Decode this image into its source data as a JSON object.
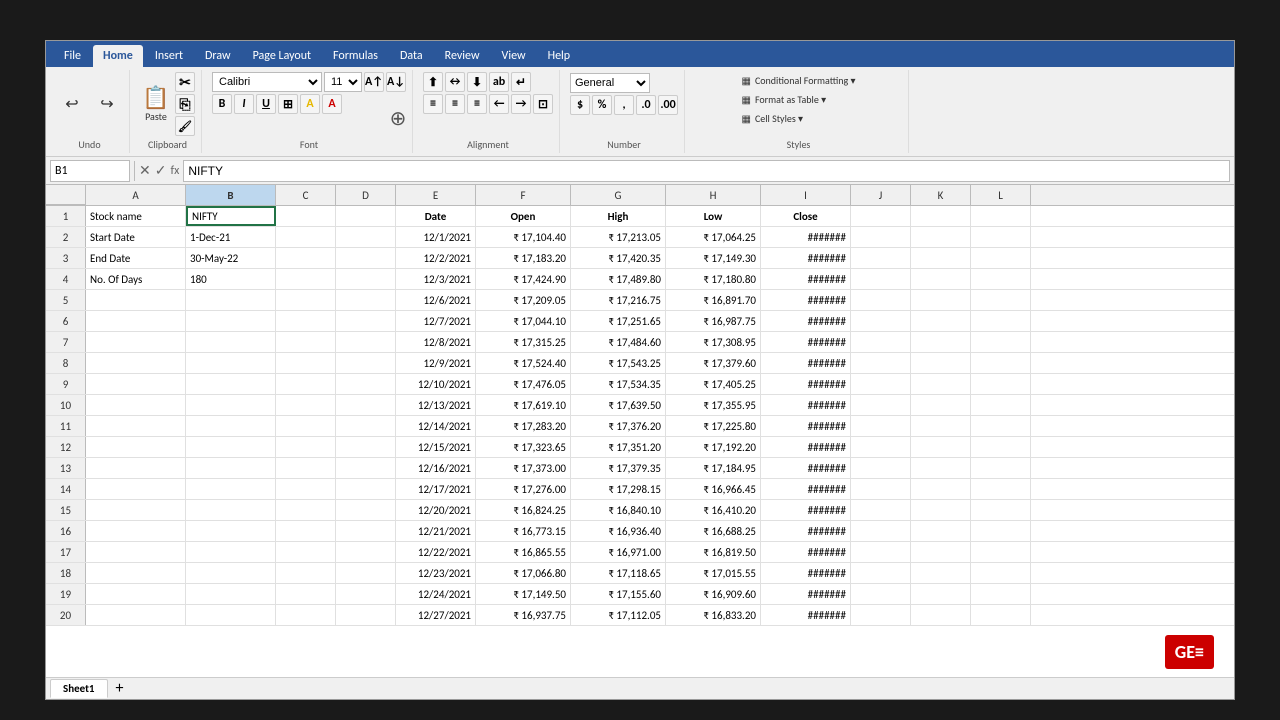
{
  "ribbon": {
    "tabs": [
      "File",
      "Home",
      "Insert",
      "Draw",
      "Page Layout",
      "Formulas",
      "Data",
      "Review",
      "View",
      "Help"
    ],
    "active_tab": "Home",
    "font_name": "Calibri",
    "font_size": "11",
    "cell_ref": "B1",
    "formula_value": "NIFTY"
  },
  "columns": {
    "headers": [
      "A",
      "B",
      "C",
      "D",
      "E",
      "F",
      "G",
      "H",
      "I",
      "J",
      "K",
      "L"
    ]
  },
  "rows": [
    {
      "num": 1,
      "cells": [
        "Stock name",
        "NIFTY",
        "",
        "",
        "Date",
        "Open",
        "High",
        "Low",
        "Close",
        "",
        "",
        ""
      ]
    },
    {
      "num": 2,
      "cells": [
        "Start Date",
        "1-Dec-21",
        "",
        "",
        "12/1/2021",
        "₹ 17,104.40",
        "₹ 17,213.05",
        "₹ 17,064.25",
        "#######",
        "",
        "",
        ""
      ]
    },
    {
      "num": 3,
      "cells": [
        "End Date",
        "30-May-22",
        "",
        "",
        "12/2/2021",
        "₹ 17,183.20",
        "₹ 17,420.35",
        "₹ 17,149.30",
        "#######",
        "",
        "",
        ""
      ]
    },
    {
      "num": 4,
      "cells": [
        "No. Of Days",
        "180",
        "",
        "",
        "12/3/2021",
        "₹ 17,424.90",
        "₹ 17,489.80",
        "₹ 17,180.80",
        "#######",
        "",
        "",
        ""
      ]
    },
    {
      "num": 5,
      "cells": [
        "",
        "",
        "",
        "",
        "12/6/2021",
        "₹ 17,209.05",
        "₹ 17,216.75",
        "₹ 16,891.70",
        "#######",
        "",
        "",
        ""
      ]
    },
    {
      "num": 6,
      "cells": [
        "",
        "",
        "",
        "",
        "12/7/2021",
        "₹ 17,044.10",
        "₹ 17,251.65",
        "₹ 16,987.75",
        "#######",
        "",
        "",
        ""
      ]
    },
    {
      "num": 7,
      "cells": [
        "",
        "",
        "",
        "",
        "12/8/2021",
        "₹ 17,315.25",
        "₹ 17,484.60",
        "₹ 17,308.95",
        "#######",
        "",
        "",
        ""
      ]
    },
    {
      "num": 8,
      "cells": [
        "",
        "",
        "",
        "",
        "12/9/2021",
        "₹ 17,524.40",
        "₹ 17,543.25",
        "₹ 17,379.60",
        "#######",
        "",
        "",
        ""
      ]
    },
    {
      "num": 9,
      "cells": [
        "",
        "",
        "",
        "",
        "12/10/2021",
        "₹ 17,476.05",
        "₹ 17,534.35",
        "₹ 17,405.25",
        "#######",
        "",
        "",
        ""
      ]
    },
    {
      "num": 10,
      "cells": [
        "",
        "",
        "",
        "",
        "12/13/2021",
        "₹ 17,619.10",
        "₹ 17,639.50",
        "₹ 17,355.95",
        "#######",
        "",
        "",
        ""
      ]
    },
    {
      "num": 11,
      "cells": [
        "",
        "",
        "",
        "",
        "12/14/2021",
        "₹ 17,283.20",
        "₹ 17,376.20",
        "₹ 17,225.80",
        "#######",
        "",
        "",
        ""
      ]
    },
    {
      "num": 12,
      "cells": [
        "",
        "",
        "",
        "",
        "12/15/2021",
        "₹ 17,323.65",
        "₹ 17,351.20",
        "₹ 17,192.20",
        "#######",
        "",
        "",
        ""
      ]
    },
    {
      "num": 13,
      "cells": [
        "",
        "",
        "",
        "",
        "12/16/2021",
        "₹ 17,373.00",
        "₹ 17,379.35",
        "₹ 17,184.95",
        "#######",
        "",
        "",
        ""
      ]
    },
    {
      "num": 14,
      "cells": [
        "",
        "",
        "",
        "",
        "12/17/2021",
        "₹ 17,276.00",
        "₹ 17,298.15",
        "₹ 16,966.45",
        "#######",
        "",
        "",
        ""
      ]
    },
    {
      "num": 15,
      "cells": [
        "",
        "",
        "",
        "",
        "12/20/2021",
        "₹ 16,824.25",
        "₹ 16,840.10",
        "₹ 16,410.20",
        "#######",
        "",
        "",
        ""
      ]
    },
    {
      "num": 16,
      "cells": [
        "",
        "",
        "",
        "",
        "12/21/2021",
        "₹ 16,773.15",
        "₹ 16,936.40",
        "₹ 16,688.25",
        "#######",
        "",
        "",
        ""
      ]
    },
    {
      "num": 17,
      "cells": [
        "",
        "",
        "",
        "",
        "12/22/2021",
        "₹ 16,865.55",
        "₹ 16,971.00",
        "₹ 16,819.50",
        "#######",
        "",
        "",
        ""
      ]
    },
    {
      "num": 18,
      "cells": [
        "",
        "",
        "",
        "",
        "12/23/2021",
        "₹ 17,066.80",
        "₹ 17,118.65",
        "₹ 17,015.55",
        "#######",
        "",
        "",
        ""
      ]
    },
    {
      "num": 19,
      "cells": [
        "",
        "",
        "",
        "",
        "12/24/2021",
        "₹ 17,149.50",
        "₹ 17,155.60",
        "₹ 16,909.60",
        "#######",
        "",
        "",
        ""
      ]
    },
    {
      "num": 20,
      "cells": [
        "",
        "",
        "",
        "",
        "12/27/2021",
        "₹ 16,937.75",
        "₹ 17,112.05",
        "₹ 16,833.20",
        "#######",
        "",
        "",
        ""
      ]
    }
  ],
  "sheet_tabs": [
    "Sheet1"
  ],
  "watermark": "GE≡"
}
